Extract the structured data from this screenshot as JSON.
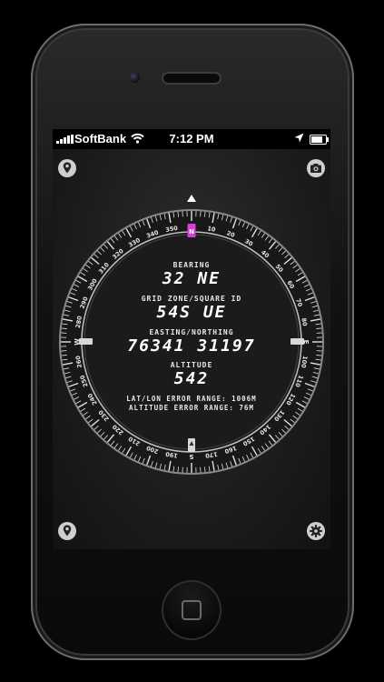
{
  "status_bar": {
    "carrier": "SoftBank",
    "time": "7:12 PM",
    "battery_level": 0.8,
    "icons": [
      "signal-icon",
      "wifi-icon",
      "location-arrow-icon",
      "battery-icon"
    ]
  },
  "toolbar": {
    "top_left_icon": "map-pin-icon",
    "top_right_icon": "camera-icon",
    "bottom_left_icon": "map-pin-icon",
    "bottom_right_icon": "gear-icon"
  },
  "compass": {
    "bearing_degrees": 32,
    "cardinals": [
      "N",
      "E",
      "S",
      "W"
    ],
    "degree_labels": [
      "10",
      "20",
      "30",
      "40",
      "50",
      "60",
      "70",
      "80",
      "100",
      "110",
      "120",
      "130",
      "140",
      "150",
      "160",
      "170",
      "190",
      "200",
      "210",
      "220",
      "230",
      "240",
      "250",
      "260",
      "280",
      "290",
      "300",
      "310",
      "320",
      "330",
      "340",
      "350"
    ],
    "accent_color": "#d63fd6"
  },
  "readout": {
    "bearing_label": "BEARING",
    "bearing_value": "32 NE",
    "grid_label": "GRID ZONE/SQUARE ID",
    "grid_value": "54S UE",
    "easting_label": "EASTING/NORTHING",
    "easting_value": "76341 31197",
    "altitude_label": "ALTITUDE",
    "altitude_value": "542",
    "latlon_error": "LAT/LON ERROR RANGE: 1006M",
    "altitude_error": "ALTITUDE ERROR RANGE: 76M"
  }
}
